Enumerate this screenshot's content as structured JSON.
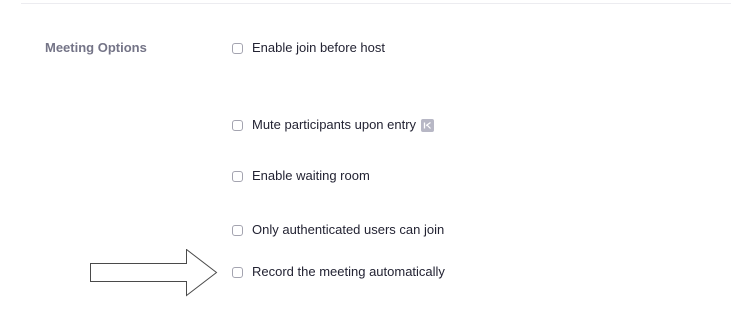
{
  "section": {
    "label": "Meeting Options"
  },
  "options": [
    {
      "label": "Enable join before host",
      "checked": false
    },
    {
      "label": "Mute participants upon entry",
      "checked": false,
      "icon": "info-badge-icon"
    },
    {
      "label": "Enable waiting room",
      "checked": false
    },
    {
      "label": "Only authenticated users can join",
      "checked": false
    },
    {
      "label": "Record the meeting automatically",
      "checked": false
    }
  ],
  "annotation": {
    "icon": "right-arrow-icon"
  },
  "colors": {
    "label_gray": "#747487",
    "text_dark": "#232333",
    "checkbox_border": "#a4a4b0",
    "badge_gray": "#b7b7c5"
  }
}
